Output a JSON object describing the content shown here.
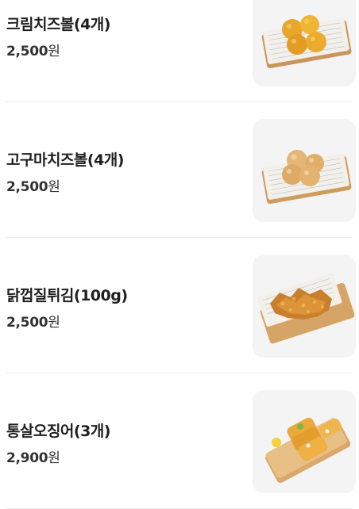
{
  "menu": {
    "items": [
      {
        "name": "크림치즈볼(4개)",
        "price": "2,500",
        "currency": "원",
        "image": "cream-cheese-balls-photo"
      },
      {
        "name": "고구마치즈볼(4개)",
        "price": "2,500",
        "currency": "원",
        "image": "sweet-potato-cheese-balls-photo"
      },
      {
        "name": "닭껍질튀김(100g)",
        "price": "2,500",
        "currency": "원",
        "image": "fried-chicken-skin-photo"
      },
      {
        "name": "통살오징어(3개)",
        "price": "2,900",
        "currency": "원",
        "image": "fried-squid-photo"
      }
    ]
  }
}
